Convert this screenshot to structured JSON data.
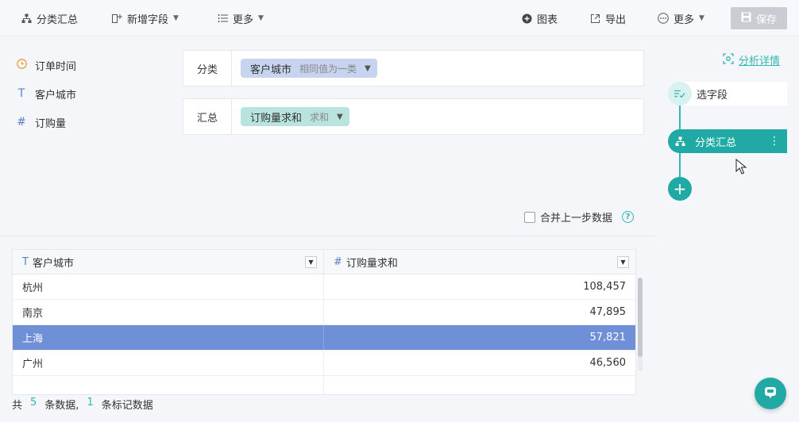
{
  "toolbar": {
    "classify_summary": "分类汇总",
    "add_field": "新增字段",
    "more_left": "更多",
    "chart": "图表",
    "export": "导出",
    "more_right": "更多",
    "save": "保存"
  },
  "fields": [
    {
      "icon": "clock-icon",
      "label": "订单时间"
    },
    {
      "icon": "text-type-icon",
      "label": "客户城市"
    },
    {
      "icon": "number-type-icon",
      "label": "订购量"
    }
  ],
  "config": {
    "category_label": "分类",
    "category_chip": "客户城市",
    "category_sub": "相同值为一类",
    "summary_label": "汇总",
    "summary_chip": "订购量求和",
    "summary_sub": "求和"
  },
  "merge": {
    "label": "合并上一步数据",
    "checked": false
  },
  "table": {
    "columns": [
      "客户城市",
      "订购量求和"
    ],
    "rows": [
      {
        "city": "杭州",
        "value": "108,457"
      },
      {
        "city": "南京",
        "value": "47,895"
      },
      {
        "city": "上海",
        "value": "57,821",
        "selected": true
      },
      {
        "city": "广州",
        "value": "46,560"
      }
    ]
  },
  "footer": {
    "prefix": "共",
    "total": "5",
    "mid": "条数据,",
    "marked": "1",
    "suffix": "条标记数据"
  },
  "flow": {
    "analysis_link": "分析详情",
    "step1": "选字段",
    "step2": "分类汇总"
  },
  "colors": {
    "accent": "#21aaa5",
    "selected_row": "#6f8fd6",
    "chip_blue": "#c7d4ef",
    "chip_teal": "#b8e3df"
  }
}
